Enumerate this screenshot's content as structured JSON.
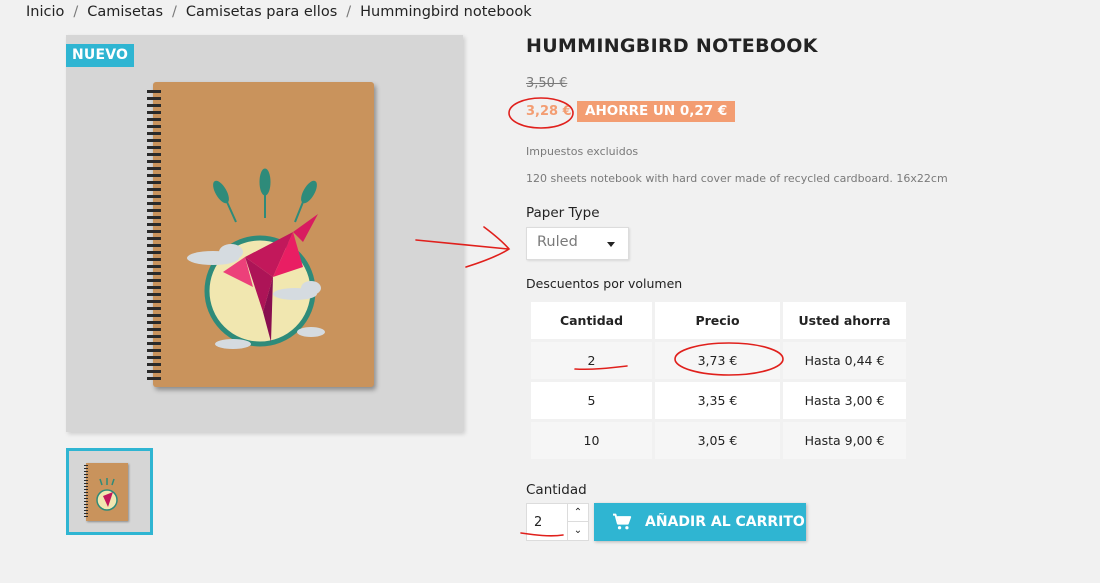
{
  "breadcrumb": {
    "items": [
      "Inicio",
      "Camisetas",
      "Camisetas para ellos",
      "Hummingbird notebook"
    ],
    "separator": "/"
  },
  "product": {
    "badge": "NUEVO",
    "title": "HUMMINGBIRD NOTEBOOK",
    "old_price": "3,50 €",
    "price": "3,28 €",
    "discount_badge": "AHORRE UN 0,27 €",
    "tax_note": "Impuestos excluidos",
    "description": "120 sheets notebook with hard cover made of recycled cardboard. 16x22cm"
  },
  "variant": {
    "label": "Paper Type",
    "selected": "Ruled"
  },
  "volume_discounts": {
    "label": "Descuentos por volumen",
    "headers": [
      "Cantidad",
      "Precio",
      "Usted ahorra"
    ],
    "rows": [
      [
        "2",
        "3,73 €",
        "Hasta 0,44 €"
      ],
      [
        "5",
        "3,35 €",
        "Hasta 3,00 €"
      ],
      [
        "10",
        "3,05 €",
        "Hasta 9,00 €"
      ]
    ]
  },
  "purchase": {
    "quantity_label": "Cantidad",
    "quantity_value": "2",
    "add_to_cart": "AÑADIR AL CARRITO"
  },
  "colors": {
    "accent": "#2fb5d2",
    "discount": "#f39d72",
    "annotation": "#e0201c"
  },
  "icons": [
    "cart-icon",
    "chevron-up-icon",
    "chevron-down-icon",
    "caret-down-icon"
  ]
}
